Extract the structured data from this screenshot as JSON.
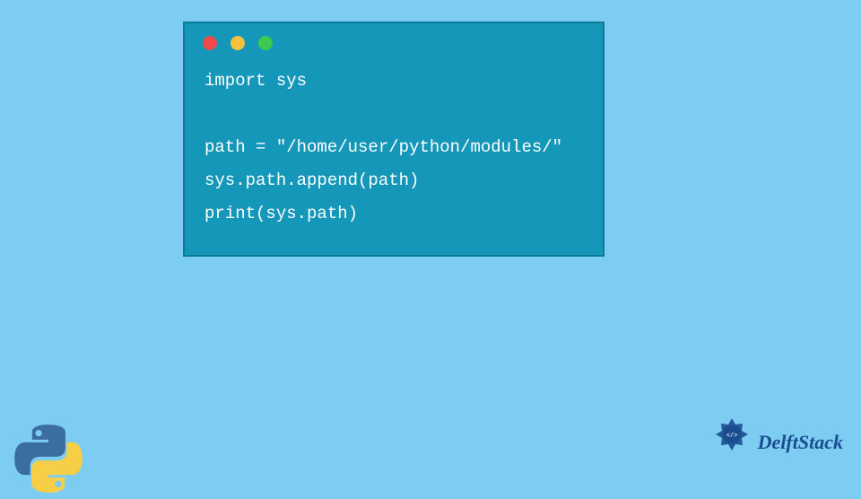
{
  "window": {
    "dots": [
      {
        "color": "#ef4b4b"
      },
      {
        "color": "#f6c13d"
      },
      {
        "color": "#3cc952"
      }
    ]
  },
  "code": {
    "line1": "import sys",
    "line2": "",
    "line3": "path = \"/home/user/python/modules/\"",
    "line4": "sys.path.append(path)",
    "line5": "print(sys.path)"
  },
  "brand": {
    "name": "DelftStack"
  },
  "colors": {
    "page_bg": "#7dcdf2",
    "window_bg": "#1497b8",
    "window_border": "#0a7a98",
    "brand_text": "#1a4d8f"
  }
}
